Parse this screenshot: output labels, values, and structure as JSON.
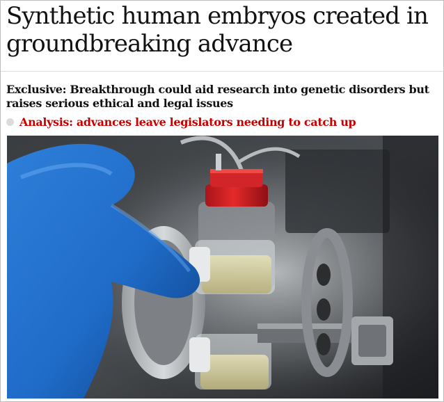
{
  "article": {
    "headline": "Synthetic human embryos created in groundbreaking advance",
    "standfirst": "Exclusive: Breakthrough could aid research into genetic disorders but raises serious ethical and legal issues",
    "related_link": "Analysis: advances leave legislators needing to catch up"
  },
  "colors": {
    "headline": "#121212",
    "related_link": "#c70000",
    "bullet": "#dcdcdc"
  }
}
